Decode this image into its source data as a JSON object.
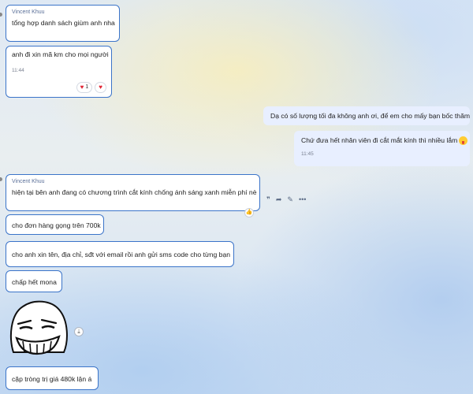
{
  "messages": {
    "m1": {
      "sender": "Vincent Khuu",
      "text": "tổng hợp danh sách giùm anh nha"
    },
    "m2": {
      "text": "anh đi xin mã km cho mọi người",
      "time": "11:44",
      "reaction_count": "1"
    },
    "m3": {
      "text": "Dạ có số lượng tối đa không anh ơi, để em cho mấy bạn bốc thăm"
    },
    "m4": {
      "text": "Chứ đưa hết nhân viên đi cắt mắt kính thì nhiều lắm",
      "time": "11:45"
    },
    "m5": {
      "sender": "Vincent Khuu",
      "text": "hiện tại bên anh đang có chương trình cắt kính chống ánh sáng xanh miễn phí nè"
    },
    "m6": {
      "text": "cho đơn hàng gọng trên 700k"
    },
    "m7": {
      "text": "cho anh xin tên, địa chỉ, sđt với email rồi anh gửi sms code cho từng bạn"
    },
    "m8": {
      "text": "chấp hết mona"
    },
    "m9": {
      "text": "cặp tròng trị giá 480k lận á"
    }
  },
  "toolbar": {
    "quote": "❞",
    "share": "➦",
    "edit": "✎",
    "more": "•••"
  },
  "icons": {
    "heart": "♥",
    "thumb": "👍",
    "download": "⤓"
  },
  "colors": {
    "bubble_border": "#3b74c9",
    "my_bubble": "#e8efff",
    "sender_name": "#5a6f98"
  }
}
